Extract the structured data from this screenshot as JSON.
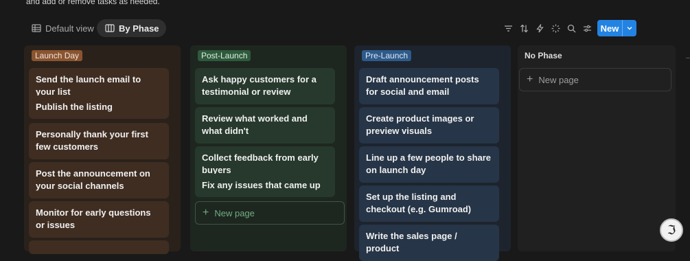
{
  "intro_text": "and add or remove tasks as needed.",
  "views": {
    "default_label": "Default view",
    "phase_label": "By Phase"
  },
  "toolbar": {
    "icons": [
      "filter-icon",
      "sort-icon",
      "automation-icon",
      "sparkle-icon",
      "search-icon",
      "settings-icon"
    ],
    "new_label": "New"
  },
  "columns": [
    {
      "title": "Launch Day",
      "color": "#8a5430",
      "cards": [
        "Send the launch email to your list",
        "Publish the listing",
        "Personally thank your first few customers",
        "Post the announcement on your social channels",
        "Monitor for early questions or issues"
      ]
    },
    {
      "title": "Post-Launch",
      "color": "#2f5a3c",
      "cards": [
        "Ask happy customers for a testimonial or review",
        "Review what worked and what didn't",
        "Collect feedback from early buyers",
        "Fix any issues that came up"
      ],
      "new_page": "New page"
    },
    {
      "title": "Pre-Launch",
      "color": "#2e5a8a",
      "cards": [
        "Draft announcement posts for social and email",
        "Create product images or preview visuals",
        "Line up a few people to share on launch day",
        "Set up the listing and checkout (e.g. Gumroad)",
        "Write the sales page / product"
      ]
    },
    {
      "title": "No Phase",
      "new_page": "New page"
    }
  ],
  "fab_symbol": "ℑ"
}
